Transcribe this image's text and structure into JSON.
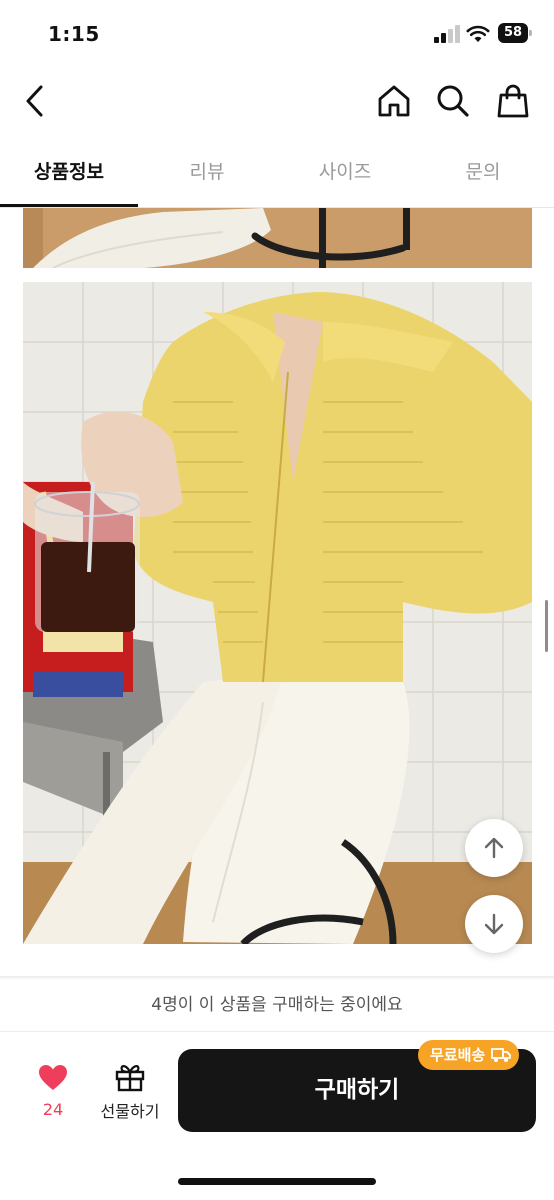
{
  "status_bar": {
    "time": "1:15",
    "battery": "58"
  },
  "navbar": {
    "back_icon": "chevron-left-icon",
    "home_icon": "home-icon",
    "search_icon": "search-icon",
    "cart_icon": "shopping-bag-icon"
  },
  "tabs": [
    {
      "label": "상품정보",
      "active": true
    },
    {
      "label": "리뷰",
      "active": false
    },
    {
      "label": "사이즈",
      "active": false
    },
    {
      "label": "문의",
      "active": false
    }
  ],
  "content": {
    "scroll_up_icon": "arrow-up-icon",
    "scroll_down_icon": "arrow-down-icon"
  },
  "bottom": {
    "buying_notice": "4명이 이 상품을 구매하는 중이에요",
    "like_count": "24",
    "gift_label": "선물하기",
    "buy_label": "구매하기",
    "free_shipping_badge": "무료배송",
    "accent_color": "#f7a325",
    "like_color": "#ef3e5b"
  }
}
